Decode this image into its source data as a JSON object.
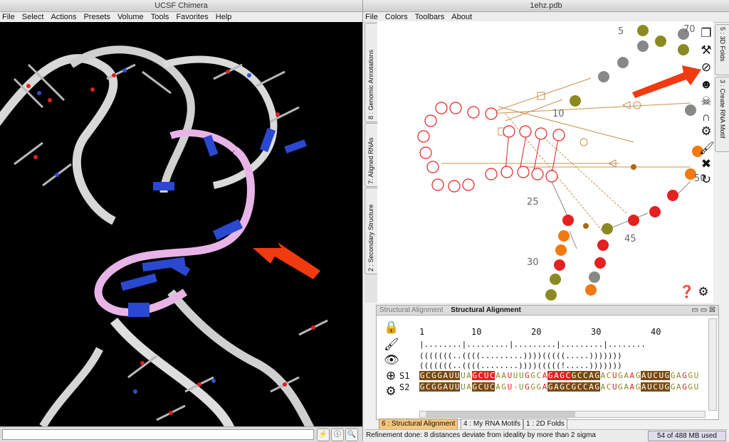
{
  "chimera": {
    "title": "UCSF Chimera",
    "menu": [
      "File",
      "Select",
      "Actions",
      "Presets",
      "Volume",
      "Tools",
      "Favorites",
      "Help"
    ],
    "command_placeholder": ""
  },
  "assemble": {
    "title": "1ehz.pdb",
    "menu": [
      "File",
      "Colors",
      "Toolbars",
      "About"
    ],
    "left_tabs": [
      "8 : Genomic Annotations",
      "7: Aligned RNAs",
      "2 : Secondary Structure"
    ],
    "right_tabs": [
      "5 : 3D Folds",
      "3 : Create RNA Motif"
    ],
    "numbers": {
      "n5": "5",
      "n10": "10",
      "n25": "25",
      "n30": "30",
      "n45": "45",
      "n50": "50",
      "n70": "70"
    },
    "alignment": {
      "tab_inactive": "Structural Alignment",
      "tab_active": "Structural Alignment",
      "ruler_numbers": [
        "1",
        "10",
        "20",
        "30",
        "40"
      ],
      "ruler_line": "|........|.........|.........|.........|........",
      "bracket1": "(((((((..((((.........))))(((((.....)))))))",
      "bracket2": "(((((((..((((........))))(((((!.....)))))))",
      "s1_label": "S1",
      "s2_label": "S2",
      "s1_seq": "GCGGAUUUAGCUCAAUUUGGCAGAGCGCCAGACUGAAGAUCUGGAGGU",
      "s2_seq": "GCGGAUUUAGCUCAGU-UGGGAGAGCGCCAGACUGAAGAUCUGGAGGU"
    },
    "bottom_tabs": [
      "6 : Structural Alignment",
      "4 : My RNA Motifs",
      "1 : 2D Folds"
    ],
    "status": "Refinement done: 8 distances deviate from ideality by more than 2 sigma",
    "memory": "54 of 488 MB used"
  },
  "colors": {
    "red": "#e52020",
    "brown": "#7a4a12",
    "olive": "#8a8a20",
    "orange": "#f07a10",
    "gray": "#888888",
    "purple_ribbon": "#e8b4e8",
    "blue": "#2040c8"
  }
}
